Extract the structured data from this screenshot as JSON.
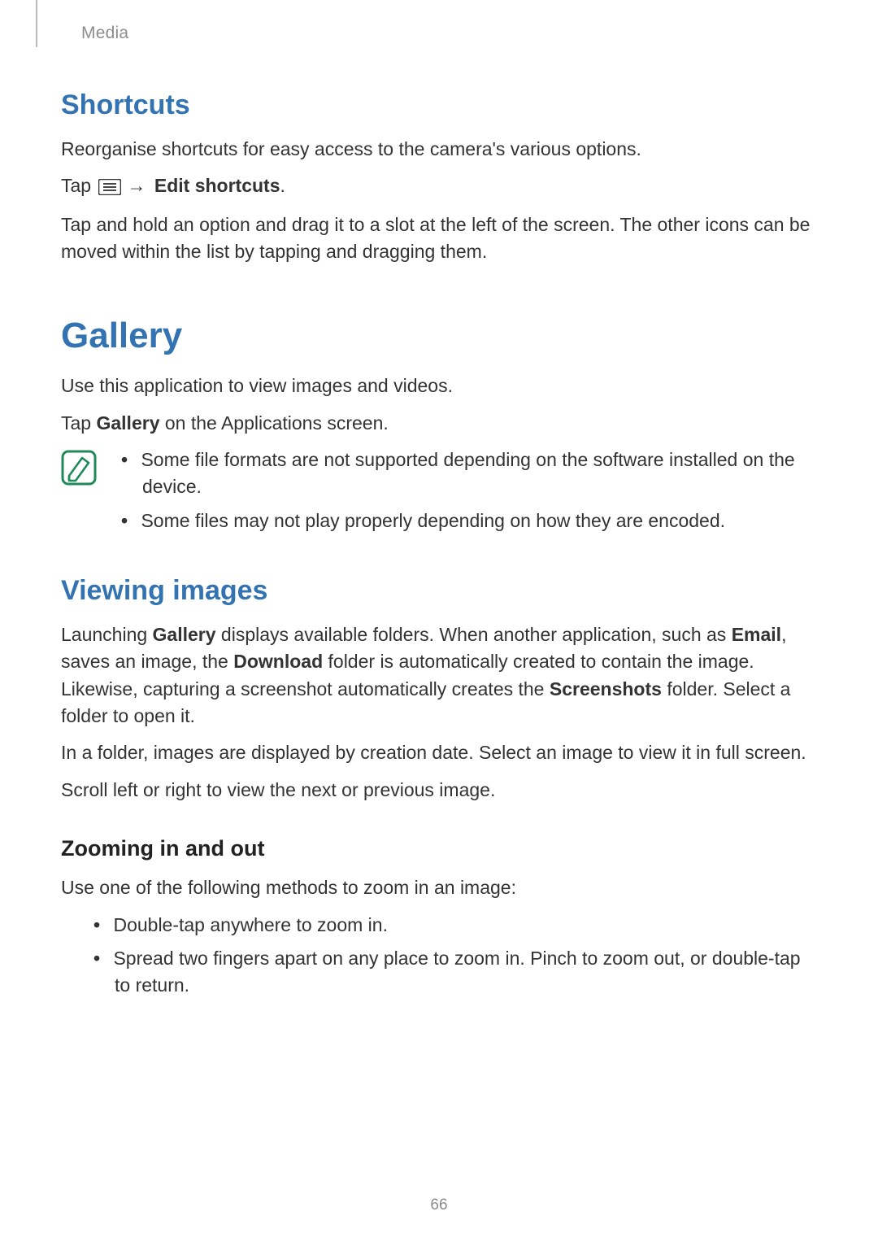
{
  "header": {
    "section": "Media"
  },
  "shortcuts": {
    "heading": "Shortcuts",
    "intro": "Reorganise shortcuts for easy access to the camera's various options.",
    "tap_prefix": "Tap ",
    "arrow": "→",
    "edit_label": "Edit shortcuts",
    "period": ".",
    "drag_text": "Tap and hold an option and drag it to a slot at the left of the screen. The other icons can be moved within the list by tapping and dragging them."
  },
  "gallery": {
    "heading": "Gallery",
    "intro": "Use this application to view images and videos.",
    "tap_prefix": "Tap ",
    "tap_bold": "Gallery",
    "tap_suffix": " on the Applications screen.",
    "notes": [
      "Some file formats are not supported depending on the software installed on the device.",
      "Some files may not play properly depending on how they are encoded."
    ]
  },
  "viewing": {
    "heading": "Viewing images",
    "para1_pre": "Launching ",
    "para1_b1": "Gallery",
    "para1_mid1": " displays available folders. When another application, such as ",
    "para1_b2": "Email",
    "para1_mid2": ", saves an image, the ",
    "para1_b3": "Download",
    "para1_mid3": " folder is automatically created to contain the image. Likewise, capturing a screenshot automatically creates the ",
    "para1_b4": "Screenshots",
    "para1_suf": " folder. Select a folder to open it.",
    "para2": "In a folder, images are displayed by creation date. Select an image to view it in full screen.",
    "para3": "Scroll left or right to view the next or previous image."
  },
  "zoom": {
    "heading": "Zooming in and out",
    "intro": "Use one of the following methods to zoom in an image:",
    "bullets": [
      "Double-tap anywhere to zoom in.",
      "Spread two fingers apart on any place to zoom in. Pinch to zoom out, or double-tap to return."
    ]
  },
  "page_number": "66"
}
